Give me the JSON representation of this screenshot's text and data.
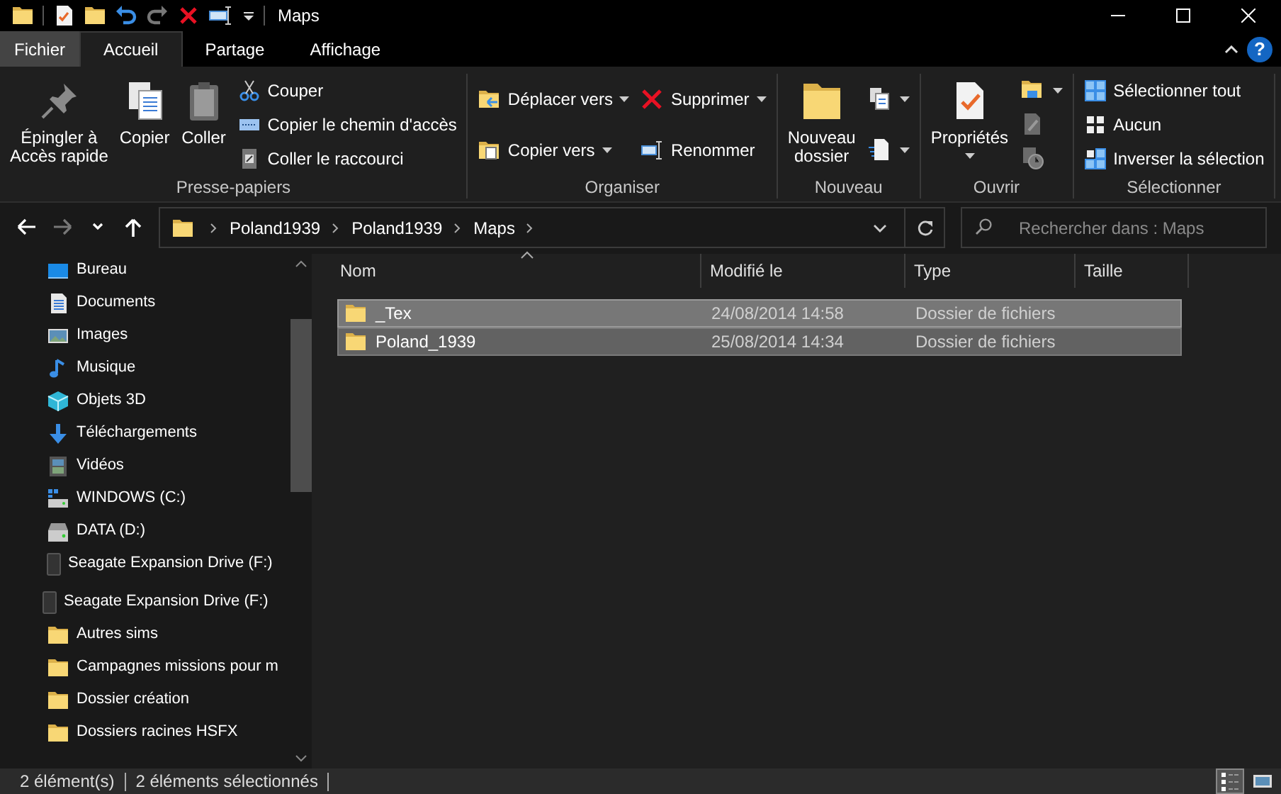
{
  "window": {
    "title": "Maps"
  },
  "tabs": [
    {
      "label": "Fichier",
      "kind": "file",
      "selected": false
    },
    {
      "label": "Accueil",
      "kind": "tab",
      "selected": true
    },
    {
      "label": "Partage",
      "kind": "tab",
      "selected": false
    },
    {
      "label": "Affichage",
      "kind": "tab",
      "selected": false
    }
  ],
  "help": "?",
  "ribbon": {
    "groups": [
      {
        "label": "Presse-papiers",
        "columns": [
          [
            {
              "lines": [
                "Épingler à",
                "Accès rapide"
              ],
              "kind": "large",
              "dropdown": false
            }
          ],
          [
            {
              "lines": [
                "Copier"
              ],
              "kind": "large",
              "dropdown": false
            }
          ],
          [
            {
              "lines": [
                "Coller"
              ],
              "kind": "large",
              "dropdown": false
            }
          ],
          [
            {
              "label": "Couper",
              "kind": "small",
              "dropdown": false
            },
            {
              "label": "Copier le chemin d'accès",
              "kind": "small",
              "dropdown": false
            },
            {
              "label": "Coller le raccourci",
              "kind": "small",
              "dropdown": false
            }
          ]
        ]
      },
      {
        "label": "Organiser",
        "columns": [
          [
            {
              "label": "Déplacer vers",
              "kind": "small",
              "dropdown": true
            },
            {
              "label": "Copier vers",
              "kind": "small",
              "dropdown": true
            }
          ],
          [
            {
              "label": "Supprimer",
              "kind": "small",
              "dropdown": true
            },
            {
              "label": "Renommer",
              "kind": "small",
              "dropdown": false
            }
          ]
        ]
      },
      {
        "label": "Nouveau",
        "columns": [
          [
            {
              "lines": [
                "Nouveau",
                "dossier"
              ],
              "kind": "large",
              "dropdown": false
            }
          ],
          [
            {
              "kind": "small",
              "dropdown": true
            },
            {
              "kind": "small",
              "dropdown": true
            }
          ]
        ]
      },
      {
        "label": "Ouvrir",
        "columns": [
          [
            {
              "lines": [
                "Propriétés"
              ],
              "kind": "large",
              "dropdown": true
            }
          ],
          [
            {
              "kind": "small",
              "dropdown": true
            },
            {
              "kind": "small",
              "dropdown": false
            },
            {
              "kind": "small",
              "dropdown": false
            }
          ]
        ]
      },
      {
        "label": "Sélectionner",
        "columns": [
          [
            {
              "label": "Sélectionner tout",
              "kind": "small",
              "dropdown": false
            },
            {
              "label": "Aucun",
              "kind": "small",
              "dropdown": false
            },
            {
              "label": "Inverser la sélection",
              "kind": "small",
              "dropdown": false
            }
          ]
        ]
      }
    ]
  },
  "navigation": [
    {
      "kind": "back",
      "disabled": false
    },
    {
      "kind": "forward",
      "disabled": true
    },
    {
      "kind": "recent",
      "disabled": false
    },
    {
      "kind": "up",
      "disabled": false
    }
  ],
  "address": {
    "breadcrumbs": [
      "Poland1939",
      "Poland1939",
      "Maps"
    ]
  },
  "search": {
    "placeholder": "Rechercher dans : Maps"
  },
  "sidebar": {
    "items": [
      {
        "label": "Bureau",
        "kind": "desktop"
      },
      {
        "label": "Documents",
        "kind": "documents"
      },
      {
        "label": "Images",
        "kind": "images"
      },
      {
        "label": "Musique",
        "kind": "music"
      },
      {
        "label": "Objets 3D",
        "kind": "objects3d"
      },
      {
        "label": "Téléchargements",
        "kind": "downloads"
      },
      {
        "label": "Vidéos",
        "kind": "videos"
      },
      {
        "label": "WINDOWS (C:)",
        "kind": "systemdrive"
      },
      {
        "label": "DATA (D:)",
        "kind": "drive"
      },
      {
        "label": "Seagate Expansion Drive (F:)",
        "kind": "external"
      },
      {
        "label": "Seagate Expansion Drive (F:)",
        "kind": "external",
        "children": [
          {
            "label": "Autres sims",
            "kind": "folder"
          },
          {
            "label": "Campagnes missions pour m",
            "kind": "folder"
          },
          {
            "label": "Dossier création",
            "kind": "folder"
          },
          {
            "label": "Dossiers racines HSFX",
            "kind": "folder"
          }
        ]
      }
    ]
  },
  "list": {
    "columns": [
      {
        "label": "Nom",
        "sorted": true
      },
      {
        "label": "Modifié le",
        "sorted": false
      },
      {
        "label": "Type",
        "sorted": false
      },
      {
        "label": "Taille",
        "sorted": false
      }
    ],
    "rows": [
      {
        "name": "_Tex",
        "modified": "24/08/2014 14:58",
        "type": "Dossier de fichiers",
        "selected": true,
        "hovered": true
      },
      {
        "name": "Poland_1939",
        "modified": "25/08/2014 14:34",
        "type": "Dossier de fichiers",
        "selected": true,
        "hovered": false
      }
    ]
  },
  "status_bar": {
    "items": [
      "2 élément(s)",
      "2 éléments sélectionnés"
    ],
    "views": [
      {
        "kind": "details",
        "selected": true
      },
      {
        "kind": "thumbnails",
        "selected": false
      }
    ]
  }
}
